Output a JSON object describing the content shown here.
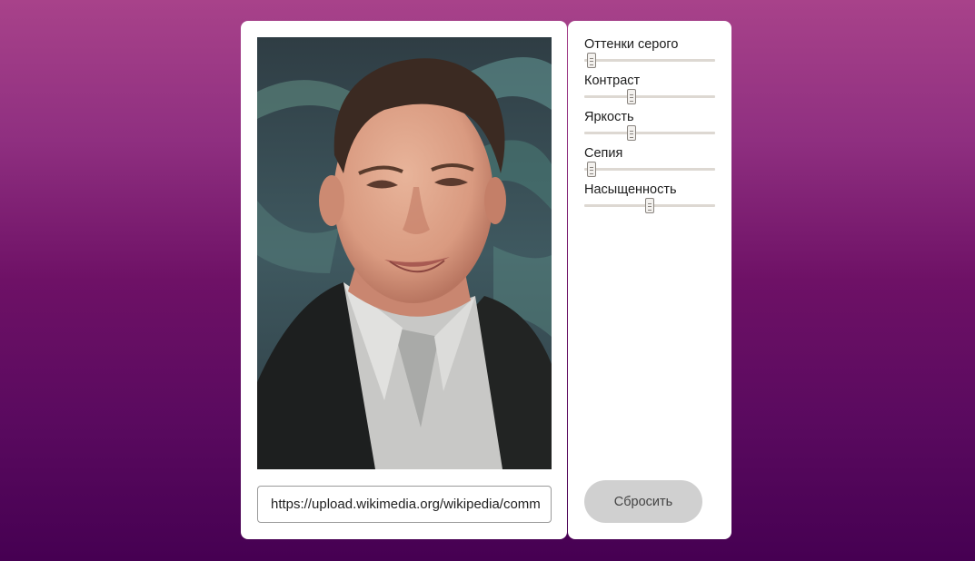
{
  "photo": {
    "url": "https://upload.wikimedia.org/wikipedia/commons/..."
  },
  "url_input": {
    "value": "https://upload.wikimedia.org/wikipedia/comm"
  },
  "filters": [
    {
      "label": "Оттенки серого",
      "value": 0.02
    },
    {
      "label": "Контраст",
      "value": 0.35
    },
    {
      "label": "Яркость",
      "value": 0.35
    },
    {
      "label": "Сепия",
      "value": 0.02
    },
    {
      "label": "Насыщенность",
      "value": 0.5
    }
  ],
  "reset": {
    "label": "Сбросить"
  },
  "colors": {
    "accent_gradient_top": "#a8428a",
    "accent_gradient_bottom": "#460052",
    "button_bg": "#d0d0d0"
  }
}
